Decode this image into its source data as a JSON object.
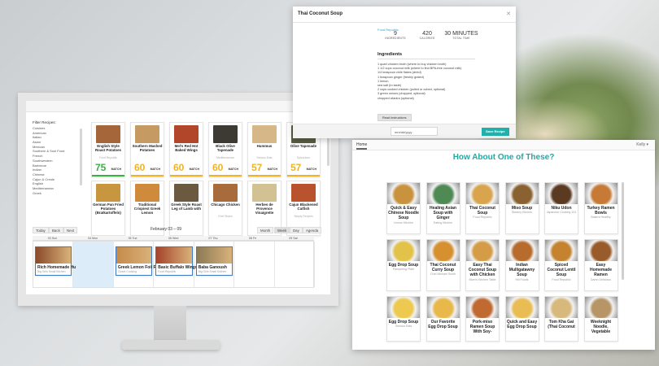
{
  "monitor": {
    "filters": {
      "title": "Filter Recipes:",
      "items": [
        "Cuisines",
        "American",
        "Italian",
        "Asian",
        "Mexican",
        "Southern & Soul Food",
        "French",
        "Southwestern",
        "Barbecue",
        "Indian",
        "Chinese",
        "Cajun & Creole",
        "English",
        "Mediterranean",
        "Greek"
      ]
    },
    "recipes": [
      {
        "title": "English Style Roast Potatoes",
        "source": "Food Republic",
        "score": "75",
        "match": "MATCH",
        "color": "#3cb043",
        "img": "#a5673a"
      },
      {
        "title": "Southern Mashed Potatoes",
        "source": "",
        "score": "60",
        "match": "MATCH",
        "color": "#f0b323",
        "img": "#c69a63"
      },
      {
        "title": "Mel's Red Hot Baked Wings",
        "source": "",
        "score": "60",
        "match": "MATCH",
        "color": "#f0b323",
        "img": "#b2462b"
      },
      {
        "title": "Black Olive Tapenade",
        "source": "Mediterranean",
        "score": "60",
        "match": "MATCH",
        "color": "#f0b323",
        "img": "#3d3a33"
      },
      {
        "title": "Hummus",
        "source": "Serious Eats",
        "score": "57",
        "match": "MATCH",
        "color": "#f0b323",
        "img": "#d6b787"
      },
      {
        "title": "Olive Tapenade",
        "source": "Epicurious",
        "score": "57",
        "match": "MATCH",
        "color": "#f0b323",
        "img": "#5a5e44"
      },
      {
        "title": "German Pan Fried Potatoes (Bratkartoffeln)",
        "source": "",
        "score": "",
        "match": "",
        "color": "#f0b323",
        "img": "#c8963f"
      },
      {
        "title": "Traditional Crispiest Greek Lemon",
        "source": "",
        "score": "",
        "match": "",
        "color": "#f0b323",
        "img": "#cf8a3b"
      },
      {
        "title": "Greek Style Roast Leg of Lamb with",
        "source": "",
        "score": "",
        "match": "",
        "color": "#f0b323",
        "img": "#6b5a3f"
      },
      {
        "title": "Chicago Chicken",
        "source": "Chef Shaun",
        "score": "",
        "match": "",
        "color": "#f0b323",
        "img": "#a86c3c"
      },
      {
        "title": "Herbes de Provence Vinaigrette",
        "source": "",
        "score": "",
        "match": "",
        "color": "#f0b323",
        "img": "#d2c193"
      },
      {
        "title": "Cajun Blackened Catfish",
        "source": "Simply Recipes",
        "score": "",
        "match": "",
        "color": "#f0b323",
        "img": "#b9532e"
      }
    ],
    "calendar": {
      "buttons": [
        "Today",
        "Back",
        "Next"
      ],
      "title": "February 03 – 09",
      "views": [
        "Month",
        "Week",
        "Day",
        "Agenda"
      ],
      "days": [
        "03 Sun",
        "04 Mon",
        "05 Tue",
        "06 Wed",
        "07 Thu",
        "08 Fri",
        "09 Sat"
      ],
      "events": [
        {
          "title": "Rich Homemade Hu",
          "sub": "Big Girls Small Kitchen",
          "img": "#8a4a2a"
        },
        {
          "title": "Greek Lemon Foil R",
          "sub": "Closet Cooking",
          "img": "#c48a4a"
        },
        {
          "title": "Basic Buffalo Wings",
          "sub": "Food Republic",
          "img": "#a5442a"
        },
        {
          "title": "Baba Ganoush",
          "sub": "Big Girls Small Kitchen",
          "img": "#8c7a55"
        }
      ]
    }
  },
  "detail": {
    "title": "Thai Coconut Soup",
    "source": "Food Republic",
    "stats": [
      {
        "num": "9",
        "label": "INGREDIENTS"
      },
      {
        "num": "420",
        "label": "CALORIES"
      },
      {
        "num": "30 MINUTES",
        "label": "TOTAL TIME"
      }
    ],
    "ingredients_title": "Ingredients",
    "ingredients": [
      "1 quart chicken broth (where to buy chicken broth)",
      "1 1/2 cups coconut milk (where to find BPA-free coconut milk)",
      "1/4 teaspoon chile flakes (dried)",
      "1 teaspoon ginger (freshly grated)",
      "1 lemon",
      "sea salt (to taste)",
      "2 cups cooked chicken (pulled or cubed, optional)",
      "3 green onions (chopped, optional)",
      "chopped cilantro (optional)"
    ],
    "read_button": "Read Instructions",
    "date_value": "mm/dd/yyyy",
    "save_button": "Save Recipe"
  },
  "suggestions": {
    "nav_home": "Home",
    "user": "Kelly",
    "title": "How About One of These?",
    "cards": [
      {
        "title": "Quick & Easy Chinese Noodle Soup",
        "source": "Lemon Kitchen",
        "img": "#c8923f"
      },
      {
        "title": "Healing Asian Soup with Ginger",
        "source": "Eating Kitchen",
        "img": "#4f8a54"
      },
      {
        "title": "Thai Coconut Soup",
        "source": "Food Republic",
        "img": "#d8a44e"
      },
      {
        "title": "Miso Soup",
        "source": "Steamy Kitchen",
        "img": "#8a6232"
      },
      {
        "title": "Niku Udon",
        "source": "Japanese Cooking 101",
        "img": "#5b3a22"
      },
      {
        "title": "Turkey Ramen Bowls",
        "source": "Bakers Healthy",
        "img": "#c77a35"
      },
      {
        "title": "Egg Drop Soup",
        "source": "Pampering Plate",
        "img": "#e3c24a"
      },
      {
        "title": "Thai Coconut Curry Soup",
        "source": "Chef Michael Smith",
        "img": "#d7902f"
      },
      {
        "title": "Easy Thai Coconut Soup with Chicken",
        "source": "Mom's Kitchen Table",
        "img": "#d59c47"
      },
      {
        "title": "Indian Mulligatawny Soup",
        "source": "Hill Foods",
        "img": "#b76b2c"
      },
      {
        "title": "Spiced Coconut Lentil Soup",
        "source": "Food Republic",
        "img": "#c5822f"
      },
      {
        "title": "Easy Homemade Ramen",
        "source": "Damn Delicious",
        "img": "#9a5b2a"
      },
      {
        "title": "Egg Drop Soup",
        "source": "Serious Eats",
        "img": "#edc94f"
      },
      {
        "title": "Our Favorite Egg Drop Soup",
        "source": "",
        "img": "#e8b84a"
      },
      {
        "title": "Pork-miso Ramen Soup With Soy-",
        "source": "",
        "img": "#c06a32"
      },
      {
        "title": "Quick and Easy Egg Drop Soup",
        "source": "",
        "img": "#e9bd54"
      },
      {
        "title": "Tom Kha Gai (Thai Coconut",
        "source": "",
        "img": "#d8b97c"
      },
      {
        "title": "Weeknight Noodle, Vegetable",
        "source": "",
        "img": "#b79566"
      }
    ]
  }
}
